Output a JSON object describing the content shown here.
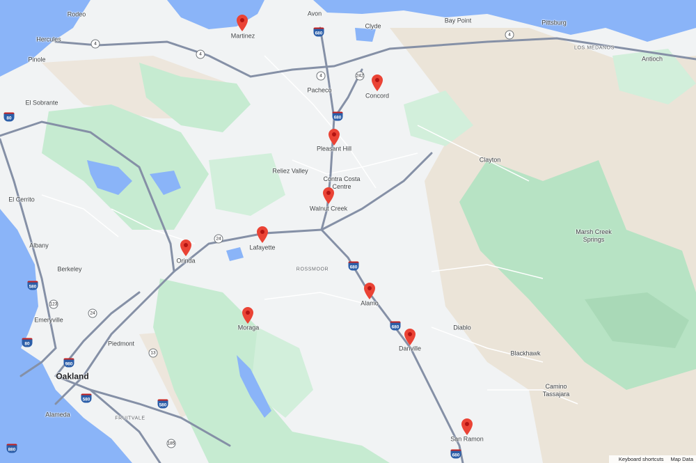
{
  "map": {
    "colors": {
      "water": "#8ab4f8",
      "land": "#f1f3f4",
      "park": "#c8ecd4",
      "hills": "#ede6dc",
      "road": "#ffffff",
      "highway": "#7d8aa0",
      "marker": "#ea4335"
    },
    "cities": [
      {
        "id": "martinez",
        "name": "Martinez"
      },
      {
        "id": "concord",
        "name": "Concord"
      },
      {
        "id": "pleasant-hill",
        "name": "Pleasant Hill"
      },
      {
        "id": "walnut-creek",
        "name": "Walnut Creek"
      },
      {
        "id": "lafayette",
        "name": "Lafayette"
      },
      {
        "id": "orinda",
        "name": "Orinda"
      },
      {
        "id": "moraga",
        "name": "Moraga"
      },
      {
        "id": "alamo",
        "name": "Alamo"
      },
      {
        "id": "danville",
        "name": "Danville"
      },
      {
        "id": "san-ramon",
        "name": "San Ramon"
      },
      {
        "id": "oakland",
        "name": "Oakland"
      }
    ],
    "places": [
      "Rodeo",
      "Hercules",
      "Pinole",
      "El Sobrante",
      "El Cerrito",
      "Albany",
      "Berkeley",
      "Emeryville",
      "Piedmont",
      "Alameda",
      "Avon",
      "Clyde",
      "Bay Point",
      "Pittsburg",
      "Antioch",
      "Pacheco",
      "Reliez Valley",
      "Contra Costa Centre",
      "Clayton",
      "Marsh Creek Springs",
      "Diablo",
      "Blackhawk",
      "Camino Tassajara"
    ],
    "districts": [
      "LOS MEDANOS",
      "ROSSMOOR",
      "FRUITVALE"
    ],
    "markers": [
      "Martinez",
      "Concord",
      "Pleasant Hill",
      "Walnut Creek",
      "Lafayette",
      "Orinda",
      "Moraga",
      "Alamo",
      "Danville",
      "San Ramon"
    ],
    "shields": [
      "80",
      "680",
      "242",
      "24",
      "580",
      "980",
      "880",
      "13",
      "185",
      "123"
    ],
    "routes": [
      "4"
    ],
    "footer": {
      "shortcuts": "Keyboard shortcuts",
      "map_data": "Map Data"
    }
  }
}
